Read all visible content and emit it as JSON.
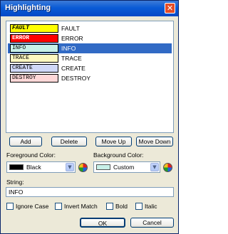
{
  "window": {
    "title": "Highlighting",
    "close_glyph": "✕"
  },
  "list": {
    "items": [
      {
        "swatch_text": "FAULT",
        "label": "FAULT",
        "bg": "#ffff00",
        "fg": "#000000",
        "bold": true,
        "italic": true,
        "selected": false
      },
      {
        "swatch_text": "ERROR",
        "label": "ERROR",
        "bg": "#ff0000",
        "fg": "#ffffff",
        "bold": true,
        "italic": false,
        "selected": false
      },
      {
        "swatch_text": "INFO",
        "label": "INFO",
        "bg": "#c8f0e8",
        "fg": "#000000",
        "bold": false,
        "italic": false,
        "selected": true
      },
      {
        "swatch_text": "TRACE",
        "label": "TRACE",
        "bg": "#fff8c0",
        "fg": "#000000",
        "bold": false,
        "italic": false,
        "selected": false
      },
      {
        "swatch_text": "CREATE",
        "label": "CREATE",
        "bg": "#d0d8f8",
        "fg": "#000000",
        "bold": false,
        "italic": false,
        "selected": false
      },
      {
        "swatch_text": "DESTROY",
        "label": "DESTROY",
        "bg": "#ffd8d8",
        "fg": "#000000",
        "bold": false,
        "italic": false,
        "selected": false
      }
    ]
  },
  "buttons": {
    "add": "Add",
    "delete": "Delete",
    "move_up": "Move Up",
    "move_down": "Move Down",
    "ok": "OK",
    "cancel": "Cancel"
  },
  "foreground": {
    "label": "Foreground Color:",
    "value": "Black",
    "swatch_color": "#000000"
  },
  "background": {
    "label": "Background Color:",
    "value": "Custom",
    "swatch_color": "#c8f0e8"
  },
  "string": {
    "label": "String:",
    "value": "INFO"
  },
  "options": {
    "ignore_case": "Ignore Case",
    "invert_match": "Invert Match",
    "bold": "Bold",
    "italic": "Italic"
  },
  "combo_arrow_glyph": "▼",
  "colors": {
    "selection": "#316ac5",
    "dialog_face": "#ece9d8",
    "title_bar": "#0a5bd6"
  }
}
